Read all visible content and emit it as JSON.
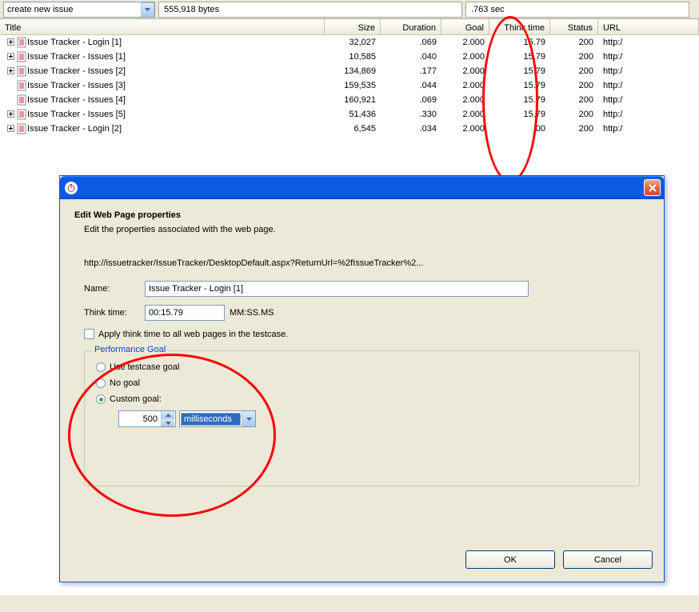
{
  "topbar": {
    "dropdown_value": "create new issue",
    "bytes": "555,918 bytes",
    "seconds": ".763 sec"
  },
  "columns": {
    "title": "Title",
    "size": "Size",
    "duration": "Duration",
    "goal": "Goal",
    "think": "Think time",
    "status": "Status",
    "url": "URL"
  },
  "rows": [
    {
      "exp": true,
      "title": "Issue Tracker - Login [1]",
      "size": "32,027",
      "dur": ".069",
      "goal": "2.000",
      "think": "15.79",
      "status": "200",
      "url": "http:/"
    },
    {
      "exp": true,
      "title": "Issue Tracker - Issues [1]",
      "size": "10,585",
      "dur": ".040",
      "goal": "2.000",
      "think": "15.79",
      "status": "200",
      "url": "http:/"
    },
    {
      "exp": true,
      "title": "Issue Tracker - Issues [2]",
      "size": "134,869",
      "dur": ".177",
      "goal": "2.000",
      "think": "15.79",
      "status": "200",
      "url": "http:/"
    },
    {
      "exp": false,
      "title": "Issue Tracker - Issues [3]",
      "size": "159,535",
      "dur": ".044",
      "goal": "2.000",
      "think": "15.79",
      "status": "200",
      "url": "http:/"
    },
    {
      "exp": false,
      "title": "Issue Tracker - Issues [4]",
      "size": "160,921",
      "dur": ".069",
      "goal": "2.000",
      "think": "15.79",
      "status": "200",
      "url": "http:/"
    },
    {
      "exp": true,
      "title": "Issue Tracker - Issues [5]",
      "size": "51,436",
      "dur": ".330",
      "goal": "2.000",
      "think": "15.79",
      "status": "200",
      "url": "http:/"
    },
    {
      "exp": true,
      "title": "Issue Tracker - Login [2]",
      "size": "6,545",
      "dur": ".034",
      "goal": "2.000",
      "think": ".00",
      "status": "200",
      "url": "http:/"
    }
  ],
  "dialog": {
    "heading": "Edit Web Page properties",
    "subheading": "Edit the properties associated with the web page.",
    "url": "http://issuetracker/IssueTracker/DesktopDefault.aspx?ReturnUrl=%2fIssueTracker%2...",
    "name_label": "Name:",
    "name_value": "Issue Tracker - Login [1]",
    "think_label": "Think time:",
    "think_value": "00:15.79",
    "think_suffix": "MM:SS.MS",
    "apply_label": "Apply think time to all web pages in the testcase.",
    "group_title": "Performance Goal",
    "radio1": "Use testcase goal",
    "radio2": "No goal",
    "radio3": "Custom goal:",
    "custom_value": "500",
    "custom_unit": "milliseconds",
    "ok": "OK",
    "cancel": "Cancel"
  }
}
